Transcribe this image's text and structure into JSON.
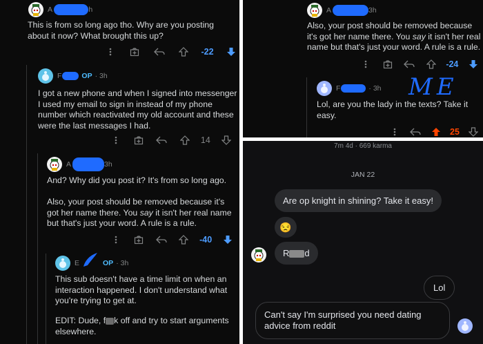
{
  "left": {
    "c1": {
      "username_initial": "A",
      "username_tail": "h",
      "text": "This is from so long ago tho. Why are you posting about it now? What brought this up?",
      "score": "-22"
    },
    "c2": {
      "username_initial": "F",
      "op_label": "OP",
      "age": "· 3h",
      "text": "I got a new phone and when I signed into messenger I used my email to sign in instead of my phone number which reactivated my old account and these were the last messages I had.",
      "score": "14"
    },
    "c3": {
      "username_initial": "A",
      "age": "3h",
      "text1": "And? Why did you post it? It's from so long ago.",
      "text2_a": "Also, your post should be removed because it's got her name there. You ",
      "text2_em": "say",
      "text2_b": " it isn't her real name but that's just your word. A rule is a rule.",
      "score": "-40"
    },
    "c4": {
      "username_initial": "E",
      "op_label": "OP",
      "age": "· 3h",
      "text1": "This sub doesn't have a time limit on when an interaction happened. I don't understand what you're trying to get at.",
      "text2_a": "EDIT: Dude, f",
      "text2_b": "k off and try to start arguments elsewhere."
    }
  },
  "rtop": {
    "c1": {
      "username_initial": "A",
      "age": "3h",
      "text_a": "Also, your post should be removed because it's got her name there. You ",
      "text_em": "say",
      "text_b": " it isn't her real name but that's just your word. A rule is a rule.",
      "score": "-24"
    },
    "c2": {
      "username_initial": "F",
      "age": "· 3h",
      "handwritten": "ME",
      "text": "Lol, are you the lady in the texts? Take it easy.",
      "score": "25"
    }
  },
  "rbot": {
    "header": "7m 4d · 669 karma",
    "date": "JAN 22",
    "msg1": "Are op knight in shining? Take it easy!",
    "emoji": "😒",
    "msg2_a": "R",
    "msg2_b": "d",
    "msg3": "Lol",
    "msg4": "Can't say I'm surprised you need dating advice from reddit"
  },
  "colors": {
    "upvote_active": "#ff4500",
    "downvote_active": "#4d9cff",
    "redaction_blue": "#1f6bff",
    "op_blue": "#4fbcff"
  }
}
